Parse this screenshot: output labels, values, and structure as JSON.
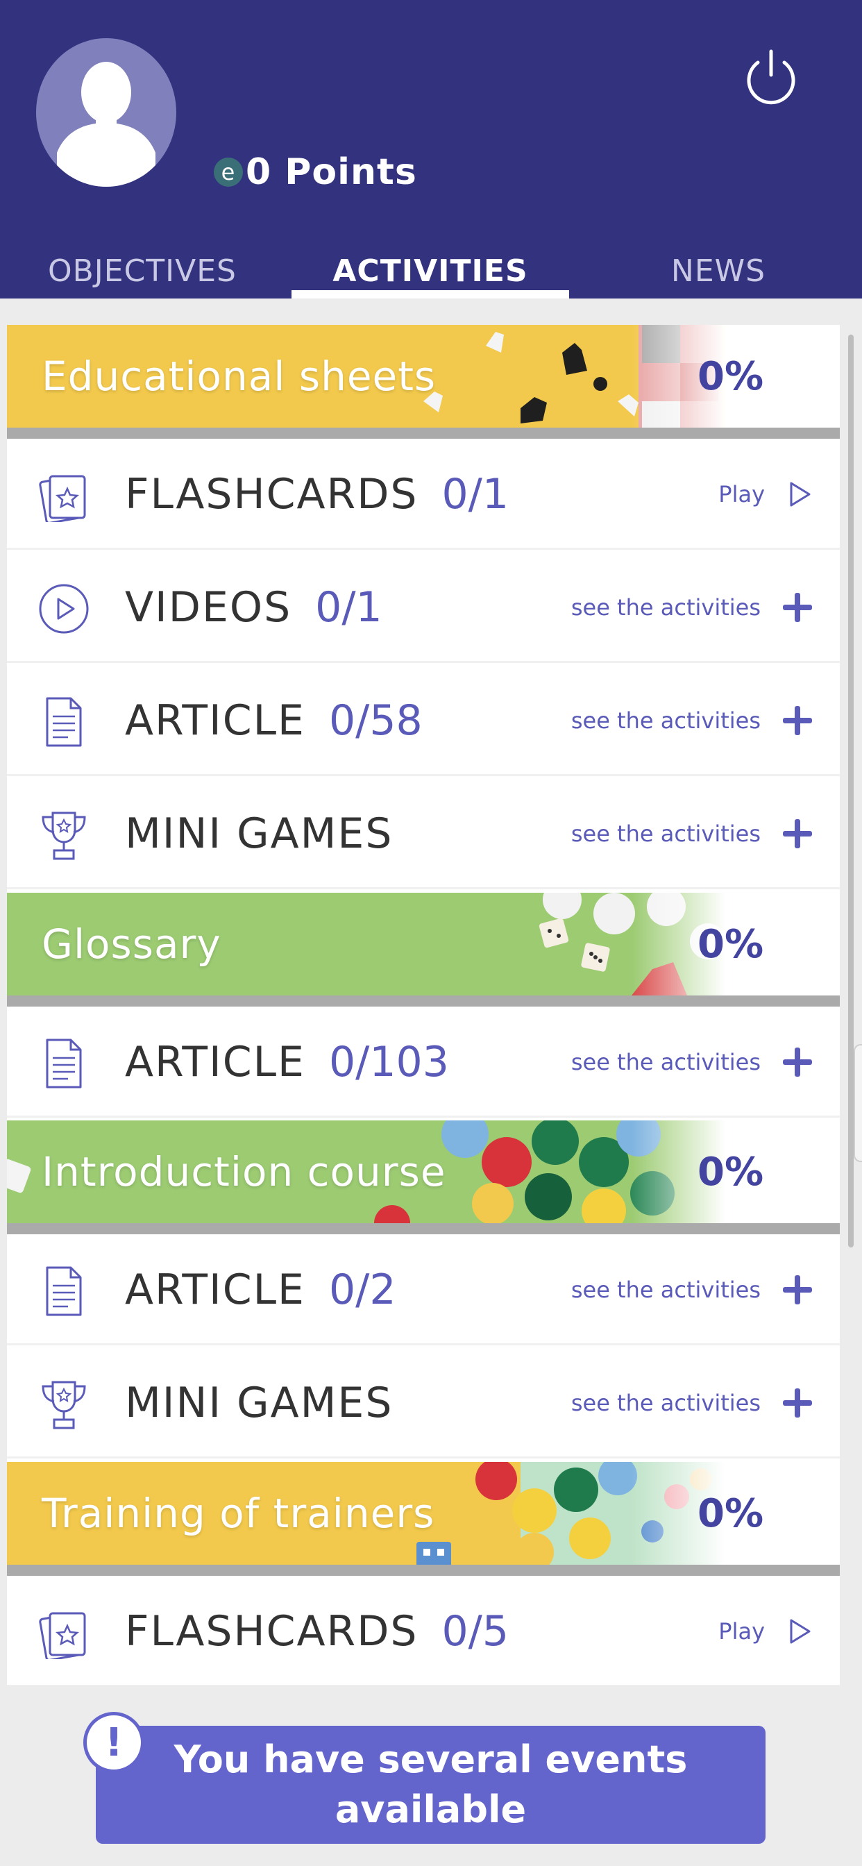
{
  "header": {
    "points_icon": "e",
    "points_label": "0 Points",
    "power_icon": "power-icon"
  },
  "tabs": [
    {
      "label": "OBJECTIVES",
      "active": false
    },
    {
      "label": "ACTIVITIES",
      "active": true
    },
    {
      "label": "NEWS",
      "active": false
    }
  ],
  "sections": [
    {
      "title": "Educational sheets",
      "percent": "0%",
      "items": [
        {
          "icon": "flashcard-icon",
          "title": "FLASHCARDS",
          "count": "0/1",
          "action": "Play"
        },
        {
          "icon": "video-icon",
          "title": "VIDEOS",
          "count": "0/1",
          "action": "see the activities"
        },
        {
          "icon": "article-icon",
          "title": "ARTICLE",
          "count": "0/58",
          "action": "see the activities"
        },
        {
          "icon": "trophy-icon",
          "title": "MINI GAMES",
          "count": "",
          "action": "see the activities"
        }
      ]
    },
    {
      "title": "Glossary",
      "percent": "0%",
      "items": [
        {
          "icon": "article-icon",
          "title": "ARTICLE",
          "count": "0/103",
          "action": "see the activities"
        }
      ]
    },
    {
      "title": "Introduction course",
      "percent": "0%",
      "items": [
        {
          "icon": "article-icon",
          "title": "ARTICLE",
          "count": "0/2",
          "action": "see the activities"
        },
        {
          "icon": "trophy-icon",
          "title": "MINI GAMES",
          "count": "",
          "action": "see the activities"
        }
      ]
    },
    {
      "title": "Training of trainers",
      "percent": "0%",
      "items": [
        {
          "icon": "flashcard-icon",
          "title": "FLASHCARDS",
          "count": "0/5",
          "action": "Play"
        }
      ]
    }
  ],
  "event_banner": {
    "alert_icon": "!",
    "label": "You have several events available"
  },
  "colors": {
    "header_bg": "#32327e",
    "accent": "#5a5ab8",
    "button_bg": "#6464cd"
  }
}
